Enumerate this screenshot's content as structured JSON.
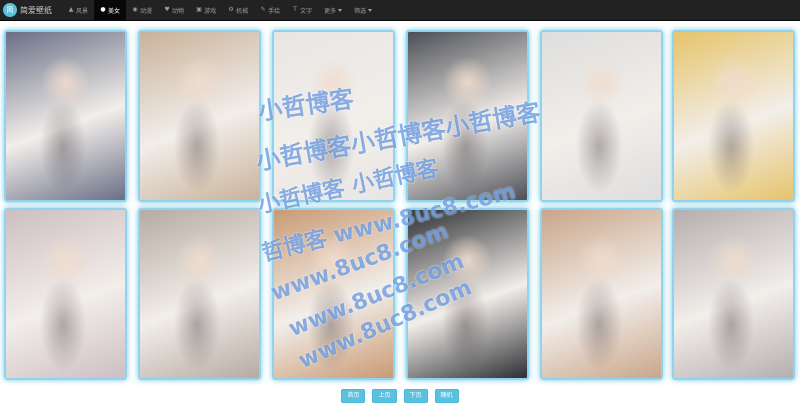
{
  "brand": {
    "logo_text": "简",
    "name": "简爱壁纸"
  },
  "nav": [
    {
      "label": "风景",
      "icon": "landscape-icon",
      "active": false
    },
    {
      "label": "美女",
      "icon": "apple-icon",
      "active": true
    },
    {
      "label": "动漫",
      "icon": "eye-icon",
      "active": false
    },
    {
      "label": "动物",
      "icon": "animal-icon",
      "active": false
    },
    {
      "label": "游戏",
      "icon": "gamepad-icon",
      "active": false
    },
    {
      "label": "机械",
      "icon": "robot-icon",
      "active": false
    },
    {
      "label": "手绘",
      "icon": "pen-icon",
      "active": false
    },
    {
      "label": "文字",
      "icon": "text-icon",
      "active": false
    },
    {
      "label": "更多",
      "icon": "",
      "dropdown": true
    },
    {
      "label": "筛选",
      "icon": "",
      "dropdown": true
    }
  ],
  "gallery": {
    "rows": 2,
    "columns": 6,
    "image_tones": [
      [
        "#6a6f86",
        "#c9b29a",
        "#e8e6e4",
        "#4c4f56",
        "#dedede",
        "#e6c46a"
      ],
      [
        "#cdbfc2",
        "#b6aba1",
        "#c99a74",
        "#2d2f33",
        "#c9a68a",
        "#b5aeb0"
      ]
    ]
  },
  "watermark": {
    "lines": [
      "小哲博客",
      "小哲博客小哲博客小哲博客",
      "小哲博客 小哲博客",
      "哲博客 www.8uc8.com",
      "www.8uc8.com",
      "www.8uc8.com",
      "www.8uc8.com"
    ],
    "color": "#2f72d0"
  },
  "pager": {
    "first": "首页",
    "prev": "上页",
    "next": "下页",
    "random": "随机"
  },
  "colors": {
    "navbar": "#222222",
    "accent": "#5bc0de",
    "glow": "#8fd3ee"
  }
}
